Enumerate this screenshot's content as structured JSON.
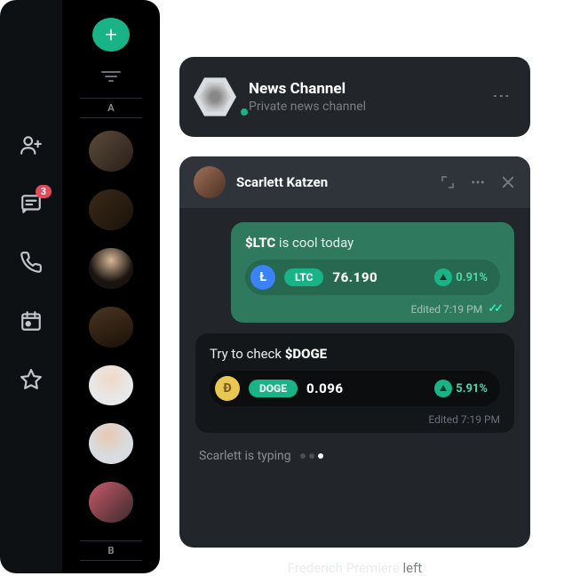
{
  "rail": {
    "badge_count": "3",
    "icons": [
      "people-icon",
      "messages-icon",
      "call-icon",
      "calendar-icon",
      "star-icon"
    ]
  },
  "contacts": {
    "add_label": "+",
    "section_a": "A",
    "section_b": "B"
  },
  "news_card": {
    "title": "News Channel",
    "subtitle": "Private news channel"
  },
  "chat": {
    "name": "Scarlett Katzen",
    "msg1": {
      "prefix": "$LTC",
      "rest": " is cool today",
      "coin_symbol": "LTC",
      "price": "76.190",
      "change": "0.91%",
      "edited": "Edited 7:19 PM"
    },
    "msg2": {
      "prefix": "Try to check ",
      "ticker": "$DOGE",
      "coin_symbol": "DOGE",
      "price": "0.096",
      "change": "5.91%",
      "edited": "Edited 7:19 PM"
    },
    "typing": "Scarlett is typing"
  },
  "footer": {
    "name": "Frederich Premiere",
    "action": " left"
  }
}
